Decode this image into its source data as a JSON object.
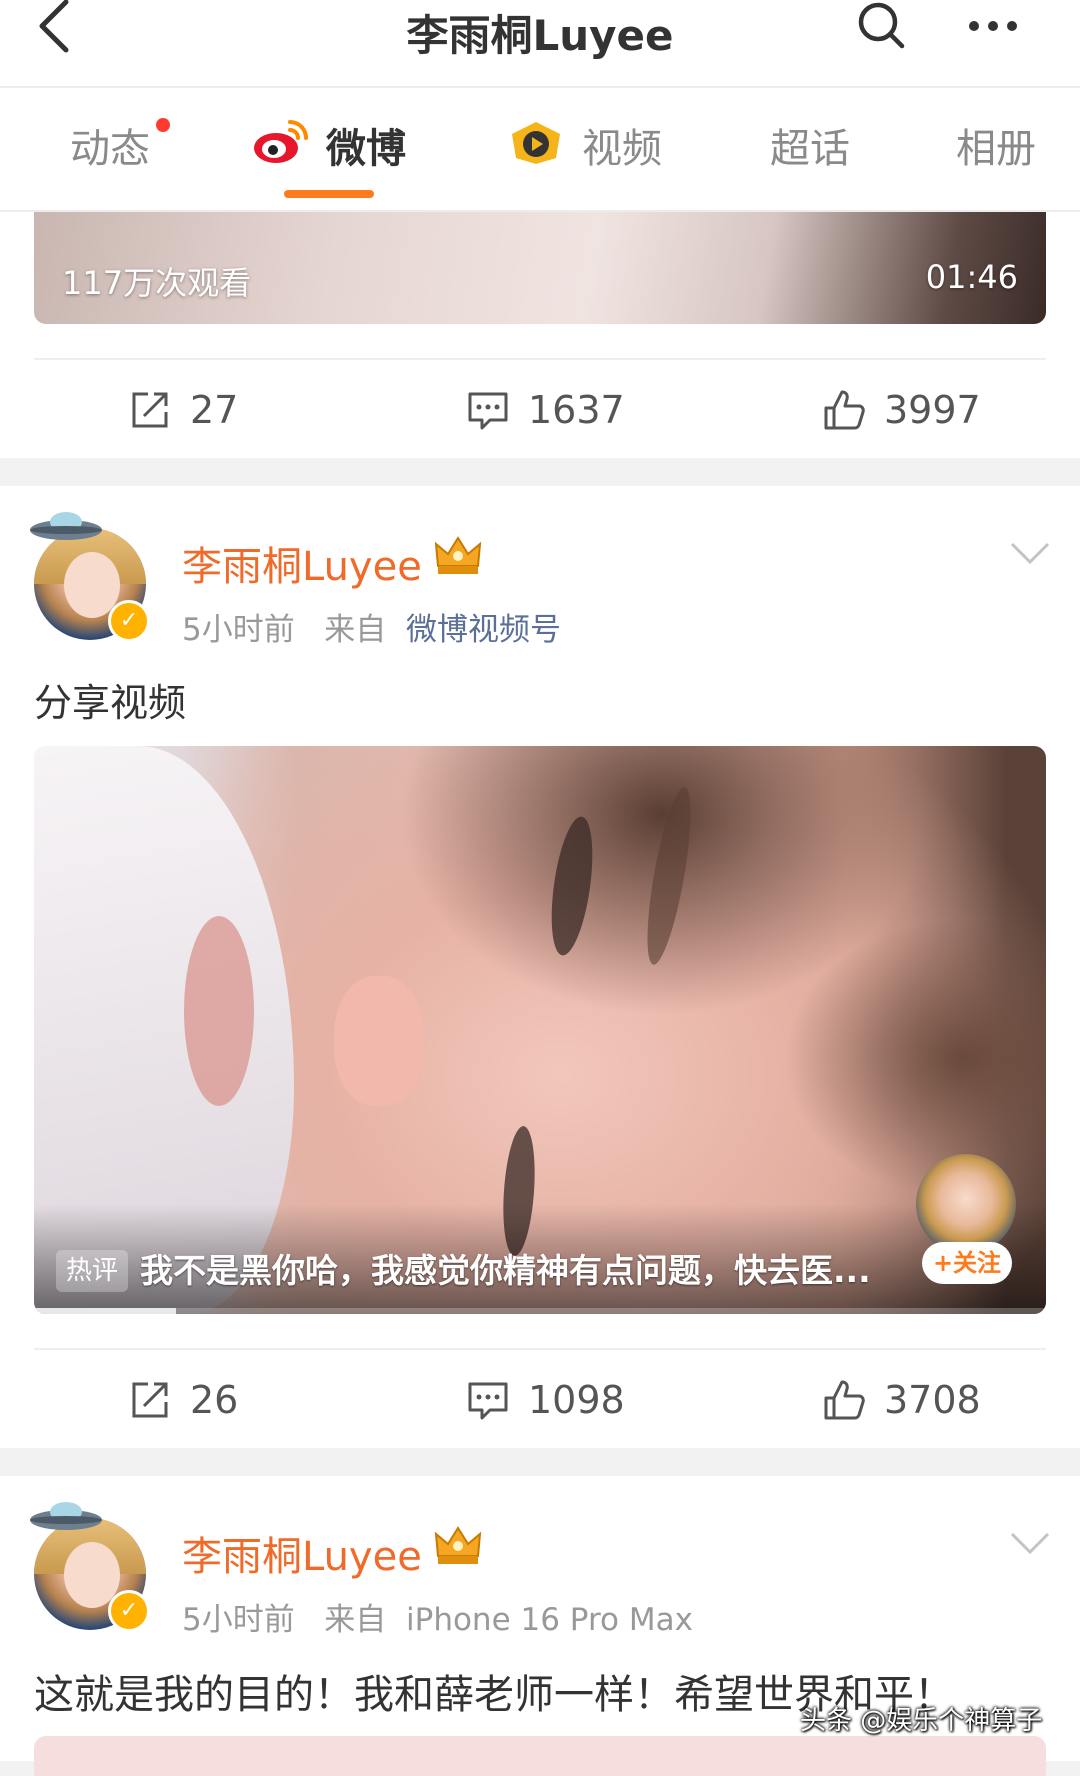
{
  "header": {
    "title": "李雨桐Luyee"
  },
  "tabs": [
    {
      "label": "动态",
      "has_dot": true
    },
    {
      "label": "微博",
      "active": true
    },
    {
      "label": "视频"
    },
    {
      "label": "超话"
    },
    {
      "label": "相册"
    }
  ],
  "prev_post": {
    "views": "117万次观看",
    "duration": "01:46",
    "reposts": "27",
    "comments": "1637",
    "likes": "3997"
  },
  "post1": {
    "username": "李雨桐Luyee",
    "time": "5小时前",
    "from_label": "来自",
    "source": "微博视频号",
    "text": "分享视频",
    "hot_tag": "热评",
    "hot_comment": "我不是黑你哈，我感觉你精神有点问题，快去医...",
    "follow_label": "+关注",
    "reposts": "26",
    "comments": "1098",
    "likes": "3708"
  },
  "post2": {
    "username": "李雨桐Luyee",
    "time": "5小时前",
    "from_label": "来自",
    "source": "iPhone 16 Pro Max",
    "text": "这就是我的目的！我和薛老师一样！希望世界和平！"
  },
  "watermark": "头条 @娱乐个神算子",
  "colors": {
    "accent": "#ff7a1a",
    "username": "#f06a2a",
    "source_link": "#5b6f99",
    "notification_dot": "#ff3b30"
  },
  "icons": [
    "back-icon",
    "search-icon",
    "more-icon",
    "weibo-logo-icon",
    "video-channel-icon",
    "repost-icon",
    "comment-icon",
    "like-icon",
    "crown-badge-icon",
    "verified-badge-icon",
    "chevron-down-icon"
  ]
}
